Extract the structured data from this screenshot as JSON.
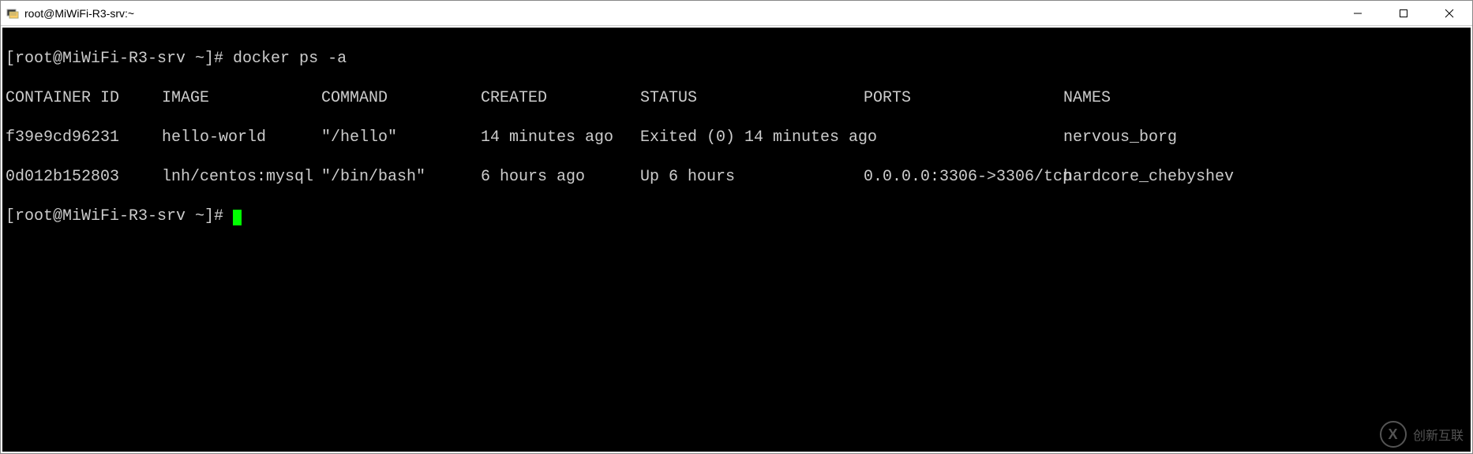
{
  "window": {
    "title": "root@MiWiFi-R3-srv:~"
  },
  "terminal": {
    "prompt1": "[root@MiWiFi-R3-srv ~]# ",
    "command1": "docker ps -a",
    "headers": {
      "id": "CONTAINER ID",
      "image": "IMAGE",
      "command": "COMMAND",
      "created": "CREATED",
      "status": "STATUS",
      "ports": "PORTS",
      "names": "NAMES"
    },
    "rows": [
      {
        "id": "f39e9cd96231",
        "image": "hello-world",
        "command": "\"/hello\"",
        "created": "14 minutes ago",
        "status": "Exited (0) 14 minutes ago",
        "ports": "",
        "names": "nervous_borg"
      },
      {
        "id": "0d012b152803",
        "image": "lnh/centos:mysql",
        "command": "\"/bin/bash\"",
        "created": "6 hours ago",
        "status": "Up 6 hours",
        "ports": "0.0.0.0:3306->3306/tcp",
        "names": "hardcore_chebyshev"
      }
    ],
    "prompt2": "[root@MiWiFi-R3-srv ~]# "
  },
  "watermark": {
    "logo_letter": "X",
    "text": "创新互联"
  }
}
